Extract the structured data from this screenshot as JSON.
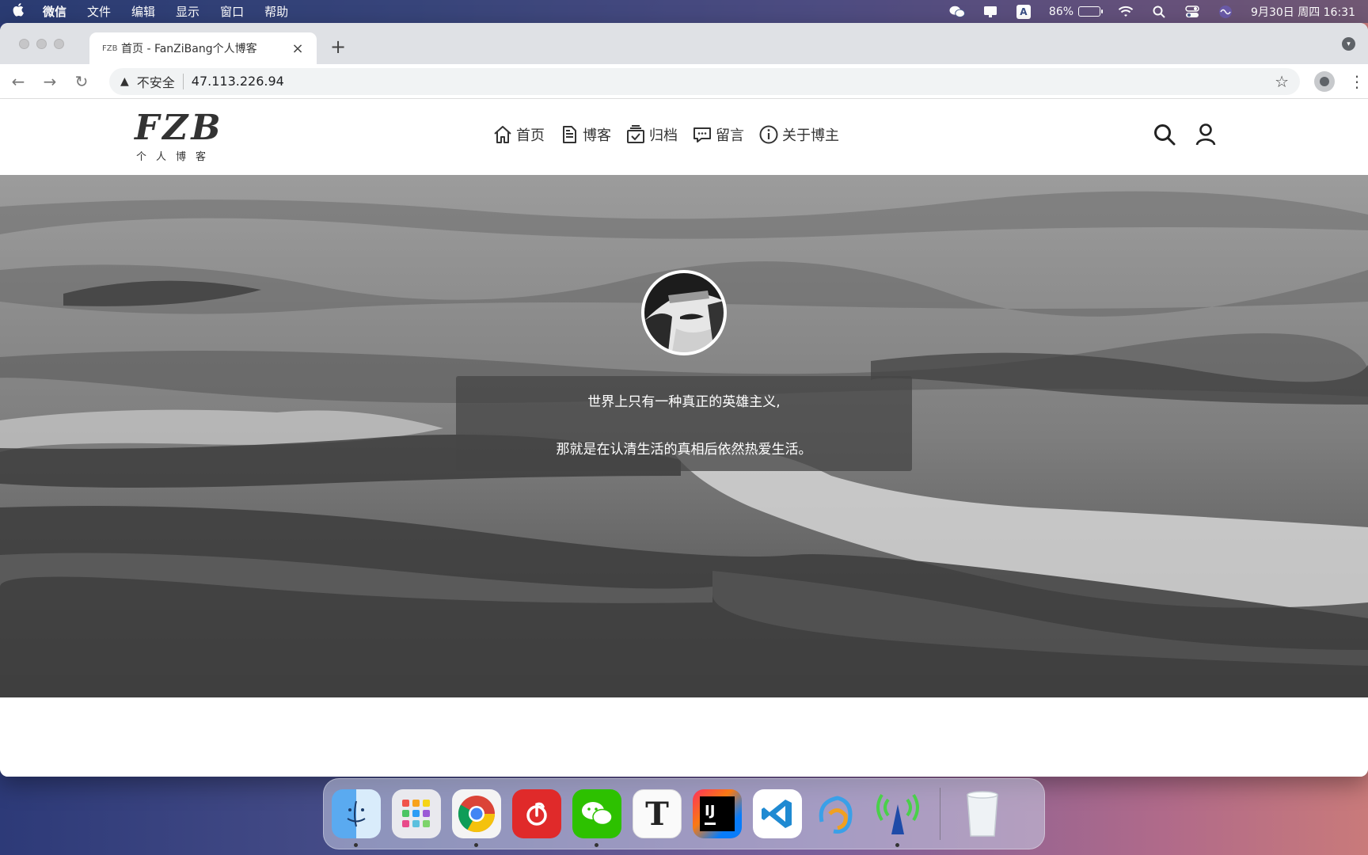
{
  "menubar": {
    "app_name": "微信",
    "items": [
      "文件",
      "编辑",
      "显示",
      "窗口",
      "帮助"
    ],
    "battery_percent_text": "86%",
    "battery_level": 0.86,
    "clock": "9月30日 周四  16:31",
    "input_source": "A"
  },
  "browser": {
    "tab_title": "首页 - FanZiBang个人博客",
    "favicon": "FZB",
    "security_label": "不安全",
    "url": "47.113.226.94"
  },
  "site": {
    "logo_main": "FZB",
    "logo_sub": "个人博客",
    "nav": [
      {
        "label": "首页",
        "icon": "home-icon"
      },
      {
        "label": "博客",
        "icon": "document-icon"
      },
      {
        "label": "归档",
        "icon": "archive-icon"
      },
      {
        "label": "留言",
        "icon": "message-icon"
      },
      {
        "label": "关于博主",
        "icon": "info-icon"
      }
    ]
  },
  "hero": {
    "quote_line1": "世界上只有一种真正的英雄主义,",
    "quote_line2": "那就是在认清生活的真相后依然热爱生活。"
  },
  "dock": {
    "apps": [
      "Finder",
      "Launchpad",
      "Chrome",
      "NetEase Music",
      "WeChat",
      "Typora",
      "IntelliJ IDEA",
      "VS Code",
      "Kuaitu",
      "Network Radar",
      "Trash"
    ]
  }
}
